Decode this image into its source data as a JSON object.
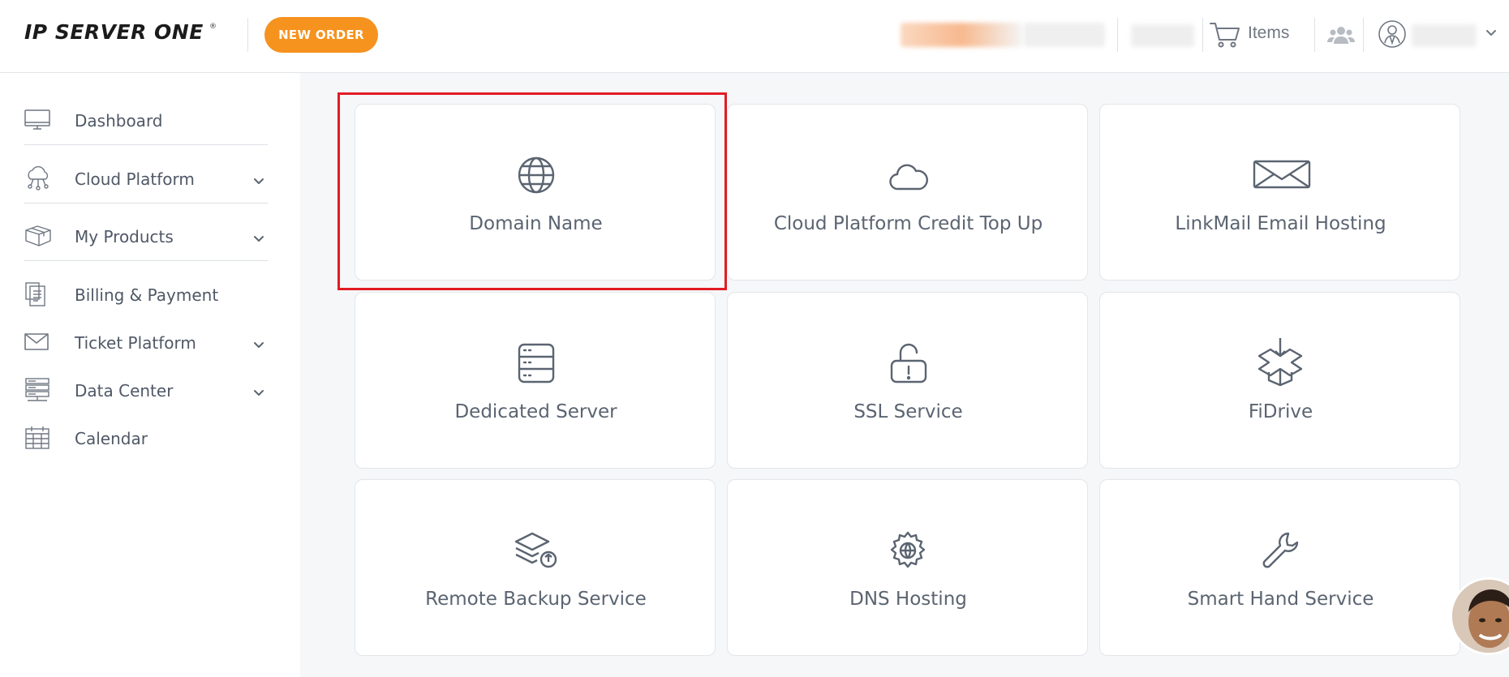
{
  "header": {
    "logo_text": "IP SERVER ONE",
    "logo_reg": "®",
    "new_order_label": "NEW ORDER",
    "cart_label": "Items"
  },
  "sidebar": {
    "items": [
      {
        "label": "Dashboard",
        "icon": "monitor-icon",
        "chevron": false
      },
      {
        "label": "Cloud Platform",
        "icon": "cloud-network-icon",
        "chevron": true
      },
      {
        "label": "My Products",
        "icon": "box-icon",
        "chevron": true
      },
      {
        "label": "Billing & Payment",
        "icon": "invoice-icon",
        "chevron": false
      },
      {
        "label": "Ticket Platform",
        "icon": "envelope-icon",
        "chevron": true
      },
      {
        "label": "Data Center",
        "icon": "server-rack-icon",
        "chevron": true
      },
      {
        "label": "Calendar",
        "icon": "calendar-icon",
        "chevron": false
      }
    ]
  },
  "cards": [
    {
      "label": "Domain Name",
      "icon": "globe-icon"
    },
    {
      "label": "Cloud Platform Credit Top Up",
      "icon": "cloud-icon"
    },
    {
      "label": "LinkMail Email Hosting",
      "icon": "mail-icon"
    },
    {
      "label": "Dedicated Server",
      "icon": "server-icon"
    },
    {
      "label": "SSL Service",
      "icon": "unlock-icon"
    },
    {
      "label": "FiDrive",
      "icon": "drive-box-icon"
    },
    {
      "label": "Remote Backup Service",
      "icon": "backup-layers-icon"
    },
    {
      "label": "DNS Hosting",
      "icon": "gear-globe-icon"
    },
    {
      "label": "Smart Hand Service",
      "icon": "wrench-icon"
    }
  ],
  "colors": {
    "accent": "#f6921e",
    "highlight": "#e21b23",
    "text": "#5b6471"
  }
}
